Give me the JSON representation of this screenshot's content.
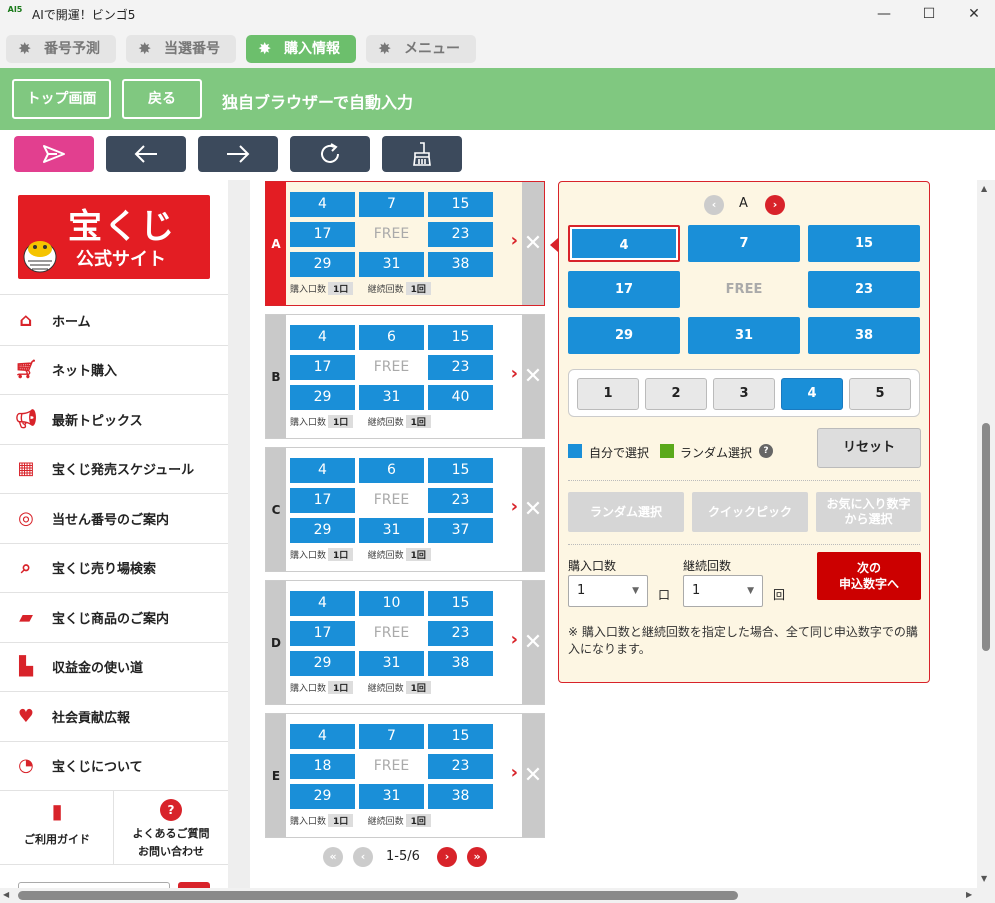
{
  "window": {
    "title": "AIで開運！ビンゴ5",
    "logo": "AI5"
  },
  "app_tabs": [
    {
      "label": "番号予測",
      "active": false
    },
    {
      "label": "当選番号",
      "active": false
    },
    {
      "label": "購入情報",
      "active": true
    },
    {
      "label": "メニュー",
      "active": false
    }
  ],
  "header": {
    "top_button": "トップ画面",
    "back_button": "戻る",
    "title": "独自ブラウザーで自動入力"
  },
  "nav_icons": [
    "send-icon",
    "arrow-left-icon",
    "arrow-right-icon",
    "reload-icon",
    "broom-icon"
  ],
  "sidebar": {
    "logo_line1": "宝くじ",
    "logo_line2": "公式サイト",
    "items": [
      {
        "label": "ホーム",
        "icon": "home-icon"
      },
      {
        "label": "ネット購入",
        "icon": "cart-icon"
      },
      {
        "label": "最新トピックス",
        "icon": "megaphone-icon"
      },
      {
        "label": "宝くじ発売スケジュール",
        "icon": "calendar-icon"
      },
      {
        "label": "当せん番号のご案内",
        "icon": "target-icon"
      },
      {
        "label": "宝くじ売り場検索",
        "icon": "store-search-icon"
      },
      {
        "label": "宝くじ商品のご案内",
        "icon": "tickets-icon"
      },
      {
        "label": "収益金の使い道",
        "icon": "building-icon"
      },
      {
        "label": "社会貢献広報",
        "icon": "heart-hands-icon"
      },
      {
        "label": "宝くじについて",
        "icon": "pie-icon"
      }
    ],
    "guide_label": "ご利用ガイド",
    "faq_line1": "よくあるご質問",
    "faq_line2": "お問い合わせ"
  },
  "tickets": [
    {
      "letter": "A",
      "active": true,
      "nums": [
        "4",
        "7",
        "15",
        "17",
        "FREE",
        "23",
        "29",
        "31",
        "38"
      ],
      "kuchi_label": "購入口数",
      "kuchi": "1口",
      "kaisu_label": "継続回数",
      "kaisu": "1回"
    },
    {
      "letter": "B",
      "active": false,
      "nums": [
        "4",
        "6",
        "15",
        "17",
        "FREE",
        "23",
        "29",
        "31",
        "40"
      ],
      "kuchi_label": "購入口数",
      "kuchi": "1口",
      "kaisu_label": "継続回数",
      "kaisu": "1回"
    },
    {
      "letter": "C",
      "active": false,
      "nums": [
        "4",
        "6",
        "15",
        "17",
        "FREE",
        "23",
        "29",
        "31",
        "37"
      ],
      "kuchi_label": "購入口数",
      "kuchi": "1口",
      "kaisu_label": "継続回数",
      "kaisu": "1回"
    },
    {
      "letter": "D",
      "active": false,
      "nums": [
        "4",
        "10",
        "15",
        "17",
        "FREE",
        "23",
        "29",
        "31",
        "38"
      ],
      "kuchi_label": "購入口数",
      "kuchi": "1口",
      "kaisu_label": "継続回数",
      "kaisu": "1回"
    },
    {
      "letter": "E",
      "active": false,
      "nums": [
        "4",
        "7",
        "15",
        "18",
        "FREE",
        "23",
        "29",
        "31",
        "38"
      ],
      "kuchi_label": "購入口数",
      "kuchi": "1口",
      "kaisu_label": "継続回数",
      "kaisu": "1回"
    }
  ],
  "pagination": {
    "text": "1-5/6"
  },
  "panel": {
    "current": "A",
    "nums": [
      "4",
      "7",
      "15",
      "17",
      "FREE",
      "23",
      "29",
      "31",
      "38"
    ],
    "selected_index": 0,
    "pages": [
      "1",
      "2",
      "3",
      "4",
      "5"
    ],
    "active_page": 3,
    "legend_self": "自分で選択",
    "legend_random": "ランダム選択",
    "color_self": "#1a8fd8",
    "color_random": "#5aa91b",
    "help": "?",
    "reset": "リセット",
    "random_btn": "ランダム選択",
    "quick_btn": "クイックピック",
    "fav_line1": "お気に入り数字",
    "fav_line2": "から選択",
    "kuchi_label": "購入口数",
    "kuchi_value": "1",
    "kuchi_unit": "口",
    "kaisu_label": "継続回数",
    "kaisu_value": "1",
    "kaisu_unit": "回",
    "next_line1": "次の",
    "next_line2": "申込数字へ",
    "note": "※ 購入口数と継続回数を指定した場合、全て同じ申込数字での購入になります。"
  },
  "colors": {
    "green": "#80c880",
    "red": "#d8232a",
    "blue": "#1a8fd8",
    "dark": "#3c4a5c",
    "pink": "#e23f8f"
  }
}
